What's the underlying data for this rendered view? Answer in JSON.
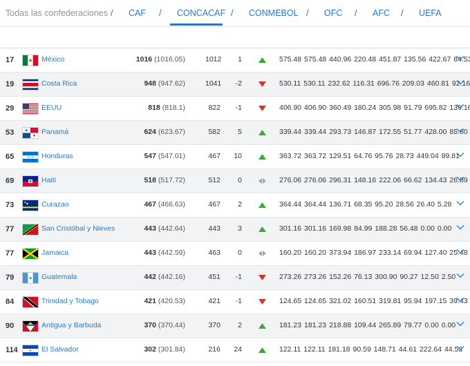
{
  "tabs": [
    {
      "label": "Todas las confederaciones"
    },
    {
      "label": "CAF"
    },
    {
      "label": "CONCACAF"
    },
    {
      "label": "CONMEBOL"
    },
    {
      "label": "OFC"
    },
    {
      "label": "AFC"
    },
    {
      "label": "UEFA"
    }
  ],
  "tab_separator": "/",
  "active_tab": "CONCACAF",
  "colors": {
    "link": "#2a78c2",
    "up": "#3aa935",
    "down": "#d9312b",
    "neutral": "#9aa4ad"
  },
  "rows": [
    {
      "rank": "17",
      "country": "México",
      "flag": "mexico-flag",
      "points": "1016",
      "points_exact": "(1016.05)",
      "prev": "1012",
      "change": "1",
      "trend": "up",
      "values": "575.48 575.48 440.96 220.48 451.87 135.56 422.67 84.53"
    },
    {
      "rank": "19",
      "country": "Costa Rica",
      "flag": "costa-rica-flag",
      "points": "948",
      "points_exact": "(947.62)",
      "prev": "1041",
      "change": "-2",
      "trend": "down",
      "values": "530.11 530.11 232.62 116.31 696.76 209.03 460.81 92.16"
    },
    {
      "rank": "29",
      "country": "EEUU",
      "flag": "usa-flag",
      "points": "818",
      "points_exact": "(818.1)",
      "prev": "822",
      "change": "-1",
      "trend": "down",
      "values": "406.90 406.90 360.49 180.24 305.98 91.79 695.82 139.16"
    },
    {
      "rank": "53",
      "country": "Panamá",
      "flag": "panama-flag",
      "points": "624",
      "points_exact": "(623.67)",
      "prev": "582",
      "change": "5",
      "trend": "up",
      "values": "339.44 339.44 293.73 146.87 172.55 51.77 428.00 85.60"
    },
    {
      "rank": "65",
      "country": "Honduras",
      "flag": "honduras-flag",
      "points": "547",
      "points_exact": "(547.01)",
      "prev": "467",
      "change": "10",
      "trend": "up",
      "values": "363.72 363.72 129.51 64.76 95.76 28.73 449.04 89.81"
    },
    {
      "rank": "69",
      "country": "Haiti",
      "flag": "haiti-flag",
      "points": "518",
      "points_exact": "(517.72)",
      "prev": "512",
      "change": "0",
      "trend": "same",
      "values": "276.06 276.06 296.31 148.16 222.06 66.62 134.43 26.89"
    },
    {
      "rank": "73",
      "country": "Curazao",
      "flag": "curacao-flag",
      "points": "467",
      "points_exact": "(466.63)",
      "prev": "467",
      "change": "2",
      "trend": "up",
      "values": "364.44 364.44 136.71 68.35 95.20 28.56 26.40 5.28"
    },
    {
      "rank": "77",
      "country": "San Cristóbal y Nieves",
      "flag": "st-kitts-flag",
      "points": "443",
      "points_exact": "(442.64)",
      "prev": "443",
      "change": "3",
      "trend": "up",
      "values": "301.16 301.16 169.98 84.99 188.28 56.48 0.00 0.00"
    },
    {
      "rank": "77",
      "country": "Jamaica",
      "flag": "jamaica-flag",
      "points": "443",
      "points_exact": "(442.59)",
      "prev": "463",
      "change": "0",
      "trend": "same",
      "values": "160.20 160.20 373.94 186.97 233.14 69.94 127.40 25.48"
    },
    {
      "rank": "79",
      "country": "Guatemala",
      "flag": "guatemala-flag",
      "points": "442",
      "points_exact": "(442.16)",
      "prev": "451",
      "change": "-1",
      "trend": "down",
      "values": "273.26 273.26 152.26 76.13 300.90 90.27 12.50 2.50"
    },
    {
      "rank": "84",
      "country": "Trinidad y Tobago",
      "flag": "trinidad-flag",
      "points": "421",
      "points_exact": "(420.53)",
      "prev": "421",
      "change": "-1",
      "trend": "down",
      "values": "124.65 124.65 321.02 160.51 319.81 95.94 197.15 39.43"
    },
    {
      "rank": "90",
      "country": "Antigua y Barbuda",
      "flag": "antigua-flag",
      "points": "370",
      "points_exact": "(370.44)",
      "prev": "370",
      "change": "2",
      "trend": "up",
      "values": "181.23 181.23 218.88 109.44 265.89 79.77 0.00 0.00"
    },
    {
      "rank": "114",
      "country": "El Salvador",
      "flag": "el-salvador-flag",
      "points": "302",
      "points_exact": "(301.84)",
      "prev": "216",
      "change": "24",
      "trend": "up",
      "values": "122.11 122.11 181.18 90.59 148.71 44.61 222.64 44.53"
    }
  ]
}
